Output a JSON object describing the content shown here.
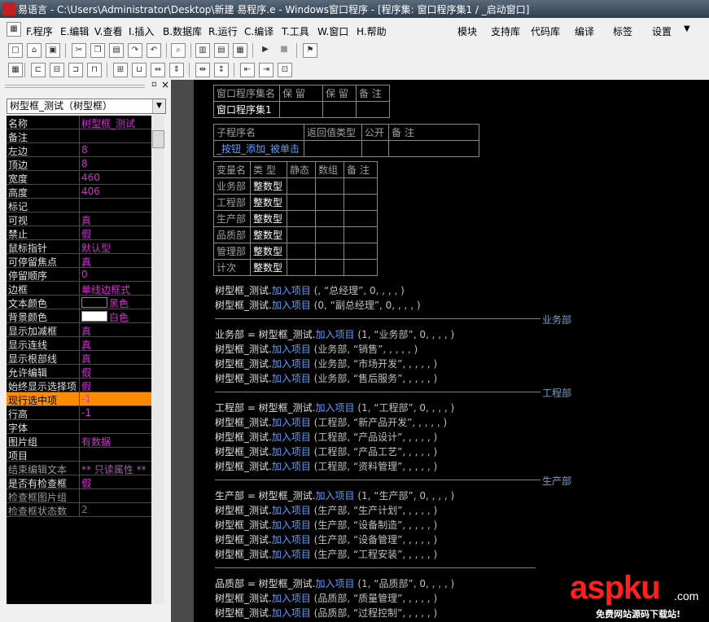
{
  "window": {
    "title": "易语言 - C:\\Users\\Administrator\\Desktop\\新建 易程序.e - Windows窗口程序 - [程序集: 窗口程序集1 / _启动窗口]"
  },
  "menu": {
    "items": [
      "F.程序",
      "E.编辑",
      "V.查看",
      "I.插入",
      "B.数据库",
      "R.运行",
      "C.编译",
      "T.工具",
      "W.窗口",
      "H.帮助"
    ],
    "right": [
      "模块",
      "支持库",
      "代码库",
      "编译",
      "标签",
      "设置"
    ]
  },
  "panel": {
    "close_label": "×",
    "combo_value": "树型框_测试（树型框）",
    "properties": [
      {
        "name": "名称",
        "value": "树型框_测试"
      },
      {
        "name": "备注",
        "value": ""
      },
      {
        "name": "左边",
        "value": "8"
      },
      {
        "name": "顶边",
        "value": "8"
      },
      {
        "name": "宽度",
        "value": "460"
      },
      {
        "name": "高度",
        "value": "406"
      },
      {
        "name": "标记",
        "value": ""
      },
      {
        "name": "可视",
        "value": "真"
      },
      {
        "name": "禁止",
        "value": "假"
      },
      {
        "name": "鼠标指针",
        "value": "默认型"
      },
      {
        "name": "可停留焦点",
        "value": "真"
      },
      {
        "name": "  停留顺序",
        "value": "0"
      },
      {
        "name": "边框",
        "value": "单线边框式"
      },
      {
        "name": "文本颜色",
        "value": "黑色",
        "swatch": "#000000"
      },
      {
        "name": "背景颜色",
        "value": "白色",
        "swatch": "#ffffff"
      },
      {
        "name": "显示加减框",
        "value": "真"
      },
      {
        "name": "显示连线",
        "value": "真"
      },
      {
        "name": "显示根部线",
        "value": "真"
      },
      {
        "name": "允许编辑",
        "value": "假"
      },
      {
        "name": "始终显示选择项",
        "value": "假"
      },
      {
        "name": "现行选中项",
        "value": "-1",
        "highlight": true
      },
      {
        "name": "行高",
        "value": "-1"
      },
      {
        "name": "字体",
        "value": ""
      },
      {
        "name": "图片组",
        "value": "有数据"
      },
      {
        "name": "项目",
        "value": ""
      },
      {
        "name": "结束编辑文本",
        "value": "** 只读属性 **",
        "dim": true
      },
      {
        "name": "是否有检查框",
        "value": "假"
      },
      {
        "name": "检查框图片组",
        "value": "",
        "dim": true
      },
      {
        "name": "检查框状态数",
        "value": "2",
        "dim": true
      }
    ]
  },
  "code": {
    "table1": {
      "headers": [
        "窗口程序集名",
        "保 留",
        "保 留",
        "备 注"
      ],
      "row": [
        "窗口程序集1",
        "",
        "",
        ""
      ]
    },
    "table2": {
      "headers": [
        "子程序名",
        "返回值类型",
        "公开",
        "备 注"
      ],
      "row": [
        "_按钮_添加_被单击",
        "",
        "",
        ""
      ]
    },
    "table3": {
      "headers": [
        "变量名",
        "类 型",
        "静态",
        "数组",
        "备 注"
      ],
      "rows": [
        [
          "业务部",
          "整数型"
        ],
        [
          "工程部",
          "整数型"
        ],
        [
          "生产部",
          "整数型"
        ],
        [
          "品质部",
          "整数型"
        ],
        [
          "管理部",
          "整数型"
        ],
        [
          "计次",
          "整数型"
        ]
      ]
    },
    "lines": [
      {
        "a": "树型框_测试.",
        "m": "加入项目",
        "p": " (, “总经理”, 0, , , , )"
      },
      {
        "a": "树型框_测试.",
        "m": "加入项目",
        "p": " (0, “副总经理”, 0, , , , )"
      },
      {
        "sep": "业务部"
      },
      {
        "a": "业务部 = 树型框_测试.",
        "m": "加入项目",
        "p": " (1, “业务部”, 0, , , , )"
      },
      {
        "a": "树型框_测试.",
        "m": "加入项目",
        "p": " (业务部, “销售”, , , , , )"
      },
      {
        "a": "树型框_测试.",
        "m": "加入项目",
        "p": " (业务部, “市场开发”, , , , , )"
      },
      {
        "a": "树型框_测试.",
        "m": "加入项目",
        "p": " (业务部, “售后服务”, , , , , )"
      },
      {
        "sep": "工程部"
      },
      {
        "a": "工程部 = 树型框_测试.",
        "m": "加入项目",
        "p": " (1, “工程部”, 0, , , , )"
      },
      {
        "a": "树型框_测试.",
        "m": "加入项目",
        "p": " (工程部, “新产品开发”, , , , , )"
      },
      {
        "a": "树型框_测试.",
        "m": "加入项目",
        "p": " (工程部, “产品设计”, , , , , )"
      },
      {
        "a": "树型框_测试.",
        "m": "加入项目",
        "p": " (工程部, “产品工艺”, , , , , )"
      },
      {
        "a": "树型框_测试.",
        "m": "加入项目",
        "p": " (工程部, “资料管理”, , , , , )"
      },
      {
        "sep": "生产部"
      },
      {
        "a": "生产部 = 树型框_测试.",
        "m": "加入项目",
        "p": " (1, “生产部”, 0, , , , )"
      },
      {
        "a": "树型框_测试.",
        "m": "加入项目",
        "p": " (生产部, “生产计划”, , , , , )"
      },
      {
        "a": "树型框_测试.",
        "m": "加入项目",
        "p": " (生产部, “设备制造”, , , , , )"
      },
      {
        "a": "树型框_测试.",
        "m": "加入项目",
        "p": " (生产部, “设备管理”, , , , , )"
      },
      {
        "a": "树型框_测试.",
        "m": "加入项目",
        "p": " (生产部, “工程安装”, , , , , )"
      },
      {
        "sep": ""
      },
      {
        "a": "品质部 = 树型框_测试.",
        "m": "加入项目",
        "p": " (1, “品质部”, 0, , , , )"
      },
      {
        "a": "树型框_测试.",
        "m": "加入项目",
        "p": " (品质部, “质量管理”, , , , , )"
      },
      {
        "a": "树型框_测试.",
        "m": "加入项目",
        "p": " (品质部, “过程控制”, , , , , )"
      }
    ]
  },
  "watermark": {
    "brand": "aspku",
    "suffix": ".com",
    "tagline": "免费网站源码下载站!"
  }
}
